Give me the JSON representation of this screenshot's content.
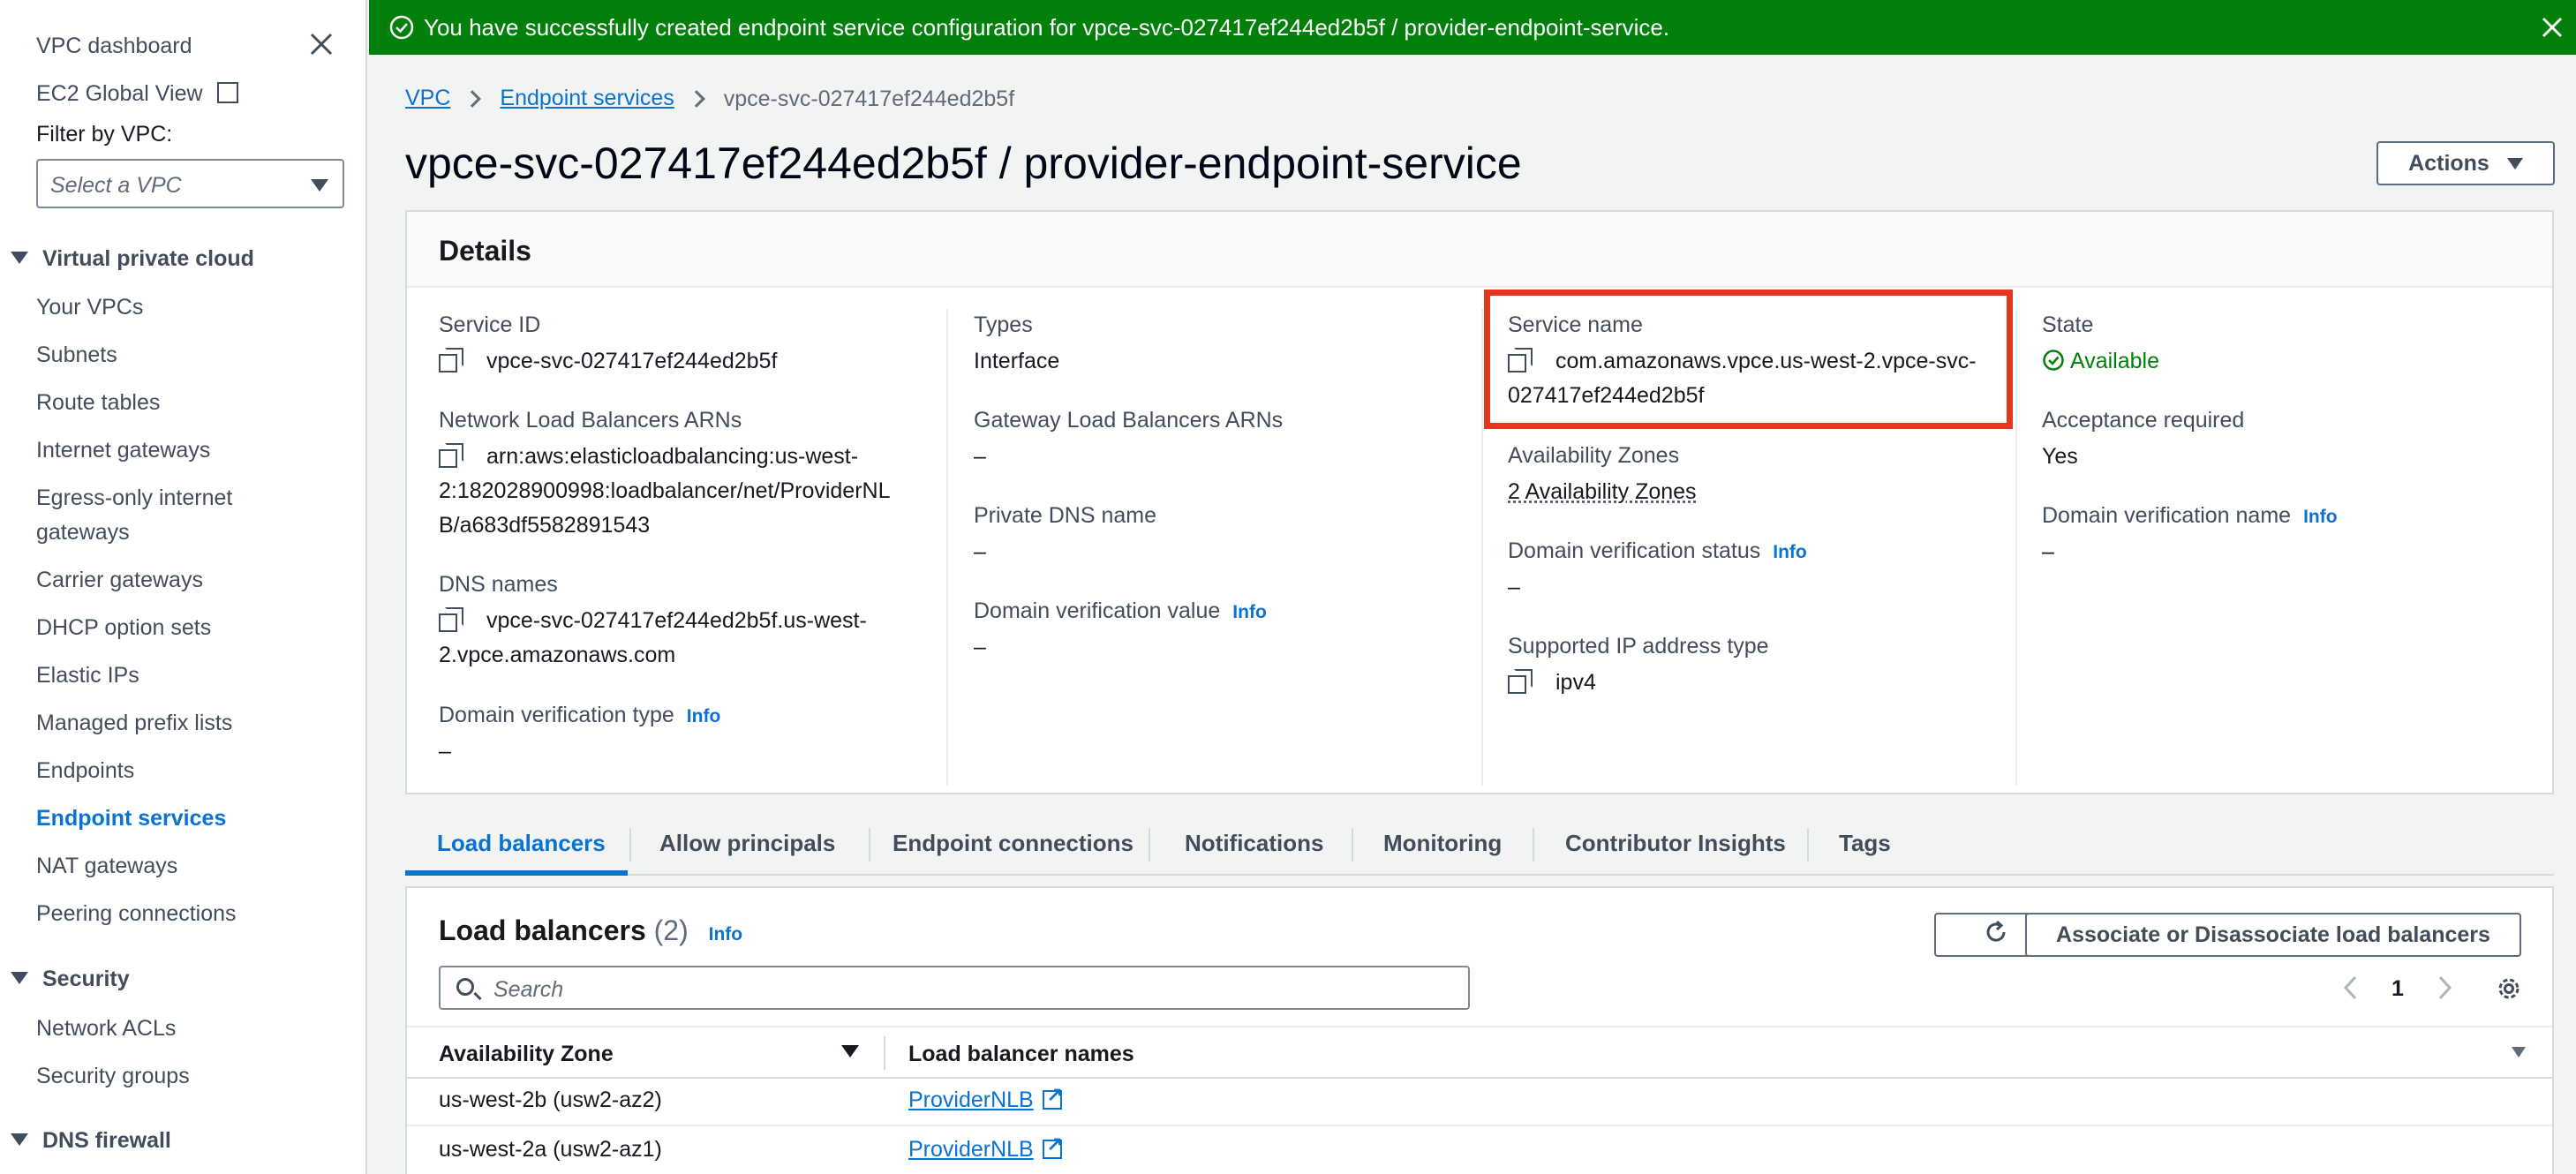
{
  "banner": {
    "message": "You have successfully created endpoint service configuration for vpce-svc-027417ef244ed2b5f / provider-endpoint-service.",
    "color": "#037f0c"
  },
  "sidebar": {
    "dashboard": "VPC dashboard",
    "ec2_global": "EC2 Global View",
    "filter_label": "Filter by VPC:",
    "filter_placeholder": "Select a VPC",
    "sections": [
      {
        "title": "Virtual private cloud",
        "items": [
          "Your VPCs",
          "Subnets",
          "Route tables",
          "Internet gateways",
          "Egress-only internet",
          "gateways",
          "Carrier gateways",
          "DHCP option sets",
          "Elastic IPs",
          "Managed prefix lists",
          "Endpoints",
          "Endpoint services",
          "NAT gateways",
          "Peering connections"
        ]
      },
      {
        "title": "Security",
        "items": [
          "Network ACLs",
          "Security groups"
        ]
      },
      {
        "title": "DNS firewall",
        "items": []
      }
    ],
    "active_item": "Endpoint services"
  },
  "breadcrumb": [
    "VPC",
    "Endpoint services",
    "vpce-svc-027417ef244ed2b5f"
  ],
  "page_title": "vpce-svc-027417ef244ed2b5f / provider-endpoint-service",
  "actions_label": "Actions",
  "details": {
    "title": "Details",
    "info": "Info",
    "service_id_label": "Service ID",
    "service_id": "vpce-svc-027417ef244ed2b5f",
    "nlb_arns_label": "Network Load Balancers ARNs",
    "nlb_arn_lines": [
      "arn:aws:elasticloadbalancing:us-west-",
      "2:182028900998:loadbalancer/net/ProviderNL",
      "B/a683df5582891543"
    ],
    "dns_names_label": "DNS names",
    "dns_lines": [
      "vpce-svc-027417ef244ed2b5f.us-west-",
      "2.vpce.amazonaws.com"
    ],
    "dv_type_label": "Domain verification type",
    "dv_type": "–",
    "types_label": "Types",
    "types": "Interface",
    "gwlb_label": "Gateway Load Balancers ARNs",
    "gwlb": "–",
    "private_dns_label": "Private DNS name",
    "private_dns": "–",
    "dv_value_label": "Domain verification value",
    "dv_value": "–",
    "service_name_label": "Service name",
    "service_name_lines": [
      "com.amazonaws.vpce.us-west-2.vpce-svc-",
      "027417ef244ed2b5f"
    ],
    "az_label": "Availability Zones",
    "az": "2 Availability Zones",
    "dv_status_label": "Domain verification status",
    "dv_status": "–",
    "ip_type_label": "Supported IP address type",
    "ip_type": "ipv4",
    "state_label": "State",
    "state": "Available",
    "acceptance_label": "Acceptance required",
    "acceptance": "Yes",
    "dv_name_label": "Domain verification name",
    "dv_name": "–"
  },
  "tabs": [
    "Load balancers",
    "Allow principals",
    "Endpoint connections",
    "Notifications",
    "Monitoring",
    "Contributor Insights",
    "Tags"
  ],
  "load_balancers": {
    "title": "Load balancers",
    "count": "(2)",
    "info": "Info",
    "associate_label": "Associate or Disassociate load balancers",
    "search_placeholder": "Search",
    "page": "1",
    "columns": [
      "Availability Zone",
      "Load balancer names"
    ],
    "rows": [
      {
        "zone": "us-west-2b (usw2-az2)",
        "name": "ProviderNLB"
      },
      {
        "zone": "us-west-2a (usw2-az1)",
        "name": "ProviderNLB"
      }
    ]
  },
  "colors": {
    "link": "#0972d3",
    "success": "#037f0c",
    "highlight": "#e3361d"
  }
}
